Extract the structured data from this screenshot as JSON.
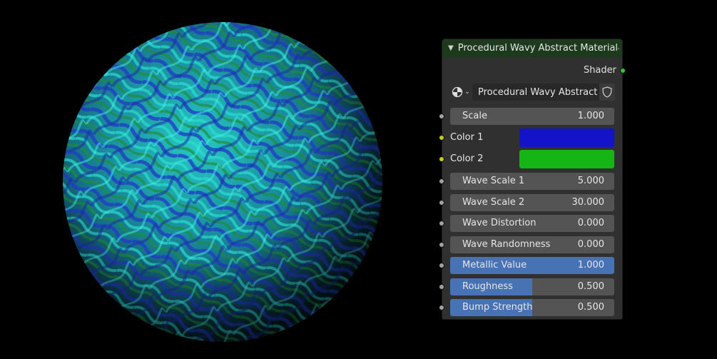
{
  "node": {
    "title": "Procedural Wavy Abstract Material",
    "output_label": "Shader",
    "material_name": "Procedural Wavy Abstract ...",
    "inputs": [
      {
        "label": "Scale",
        "value": "1.000",
        "fill": 0
      },
      {
        "label": "Wave Scale 1",
        "value": "5.000",
        "fill": 0
      },
      {
        "label": "Wave Scale 2",
        "value": "30.000",
        "fill": 0
      },
      {
        "label": "Wave Distortion",
        "value": "0.000",
        "fill": 0
      },
      {
        "label": "Wave Randomness",
        "value": "0.000",
        "fill": 0
      },
      {
        "label": "Metallic Value",
        "value": "1.000",
        "fill": 1.0
      },
      {
        "label": "Roughness",
        "value": "0.500",
        "fill": 0.5
      },
      {
        "label": "Bump Strength",
        "value": "0.500",
        "fill": 0.5
      }
    ],
    "colors": [
      {
        "label": "Color 1",
        "swatch": "#1313c8"
      },
      {
        "label": "Color 2",
        "swatch": "#14b514"
      }
    ]
  }
}
